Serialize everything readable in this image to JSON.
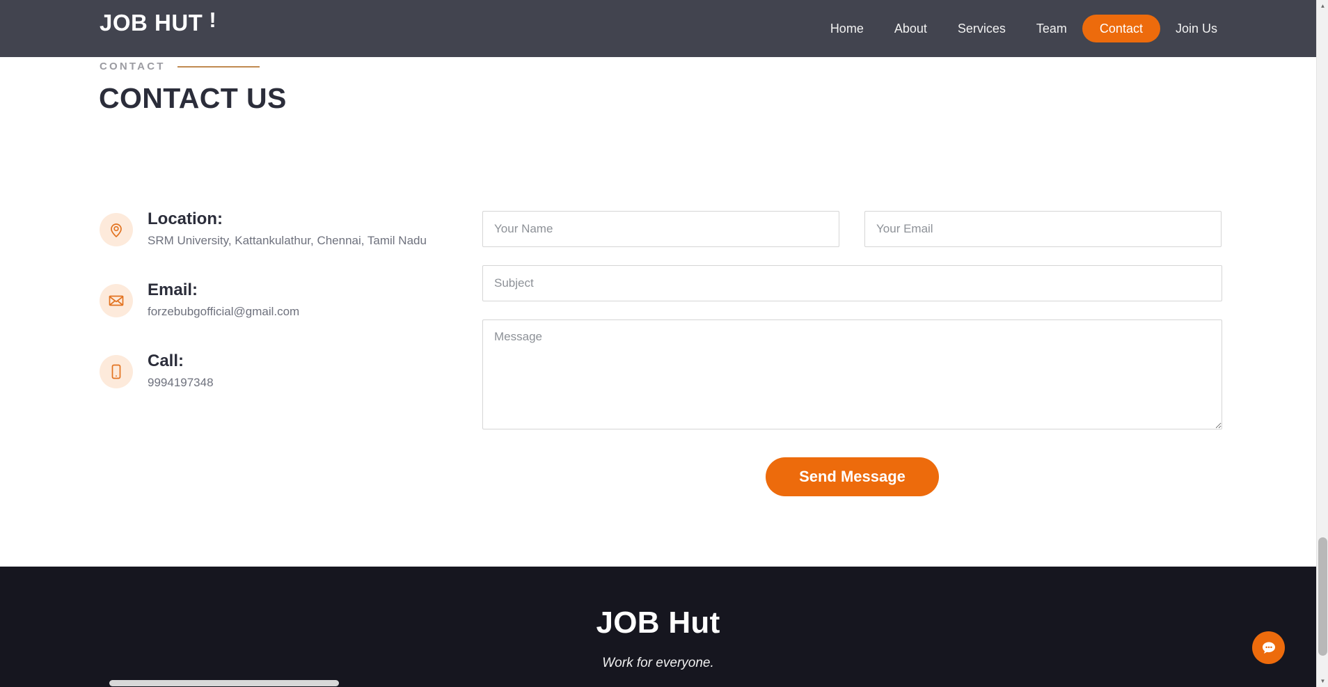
{
  "navbar": {
    "brand": "JOB HUT",
    "brand_mark": "!",
    "links": [
      {
        "label": "Home",
        "active": false
      },
      {
        "label": "About",
        "active": false
      },
      {
        "label": "Services",
        "active": false
      },
      {
        "label": "Team",
        "active": false
      },
      {
        "label": "Contact",
        "active": true
      },
      {
        "label": "Join Us",
        "active": false
      }
    ],
    "background": "#42444f",
    "active_color": "#ed6b0c"
  },
  "section": {
    "eyebrow": "CONTACT",
    "title": "CONTACT US",
    "rule_color": "#c08a50",
    "title_color": "#2b2d3a"
  },
  "contact_info": [
    {
      "icon": "map-pin-icon",
      "title": "Location:",
      "detail": "SRM University, Kattankulathur, Chennai, Tamil Nadu"
    },
    {
      "icon": "envelope-icon",
      "title": "Email:",
      "detail": "forzebubgofficial@gmail.com"
    },
    {
      "icon": "smartphone-icon",
      "title": "Call:",
      "detail": "9994197348"
    }
  ],
  "form": {
    "name": {
      "placeholder": "Your Name",
      "value": ""
    },
    "email": {
      "placeholder": "Your Email",
      "value": ""
    },
    "subject": {
      "placeholder": "Subject",
      "value": ""
    },
    "message": {
      "placeholder": "Message",
      "value": ""
    },
    "submit_label": "Send Message",
    "button_color": "#ed6b0c"
  },
  "footer": {
    "title": "JOB Hut",
    "tagline": "Work for everyone.",
    "background": "#16161f"
  },
  "chat": {
    "icon": "chat-bubble-icon",
    "color": "#ed6b0c"
  },
  "scrollbar": {
    "vertical_icon_up": "▲",
    "vertical_icon_down": "▼"
  }
}
